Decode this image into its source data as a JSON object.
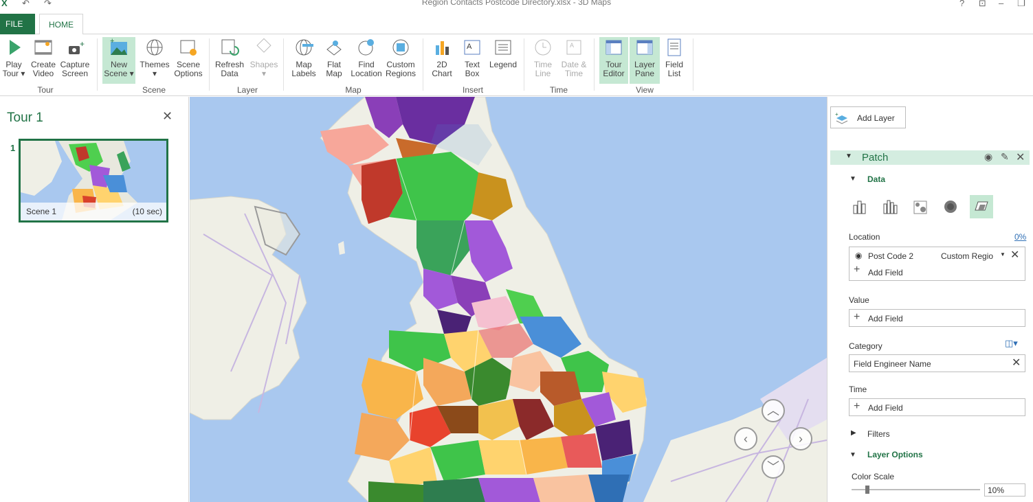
{
  "window": {
    "title": "Region Contacts Postcode Directory.xlsx - 3D Maps"
  },
  "tabs": {
    "file": "FILE",
    "home": "HOME"
  },
  "ribbon": {
    "tour_group": "Tour",
    "scene_group": "Scene",
    "layer_group": "Layer",
    "map_group": "Map",
    "insert_group": "Insert",
    "time_group": "Time",
    "view_group": "View",
    "play_tour": [
      "Play",
      "Tour ▾"
    ],
    "create_video": [
      "Create",
      "Video"
    ],
    "capture_screen": [
      "Capture",
      "Screen"
    ],
    "new_scene": [
      "New",
      "Scene ▾"
    ],
    "themes": [
      "Themes",
      "▾"
    ],
    "scene_options": [
      "Scene",
      "Options"
    ],
    "refresh_data": [
      "Refresh",
      "Data"
    ],
    "shapes": [
      "Shapes",
      "▾"
    ],
    "map_labels": [
      "Map",
      "Labels"
    ],
    "flat_map": [
      "Flat",
      "Map"
    ],
    "find_location": [
      "Find",
      "Location"
    ],
    "custom_regions": [
      "Custom",
      "Regions"
    ],
    "chart_2d": [
      "2D",
      "Chart"
    ],
    "text_box": [
      "Text",
      "Box"
    ],
    "legend": [
      "Legend",
      ""
    ],
    "time_line": [
      "Time",
      "Line"
    ],
    "date_time": [
      "Date &",
      "Time"
    ],
    "tour_editor": [
      "Tour",
      "Editor"
    ],
    "layer_pane": [
      "Layer",
      "Pane"
    ],
    "field_list": [
      "Field",
      "List"
    ]
  },
  "tour_panel": {
    "title": "Tour 1",
    "close": "✕",
    "scene_number": "1",
    "scene_name": "Scene 1",
    "scene_duration": "(10 sec)"
  },
  "layer_pane": {
    "add_layer": "Add Layer",
    "layer_name": "Patch",
    "data_section": "Data",
    "location_label": "Location",
    "location_pct": "0%",
    "location_field": "Post Code 2",
    "location_type": "Custom Regio",
    "add_field": "Add Field",
    "value_label": "Value",
    "category_label": "Category",
    "category_field": "Field Engineer Name",
    "time_label": "Time",
    "filters_label": "Filters",
    "layer_options": "Layer Options",
    "color_scale_label": "Color Scale",
    "color_scale_value": "10%"
  },
  "colors": {
    "accent": "#217346",
    "selected_bg": "#c5e8d3",
    "patch_header_bg": "#d4ede0",
    "map_sea": "#a9c8ef",
    "map_land": "#efefe6"
  }
}
